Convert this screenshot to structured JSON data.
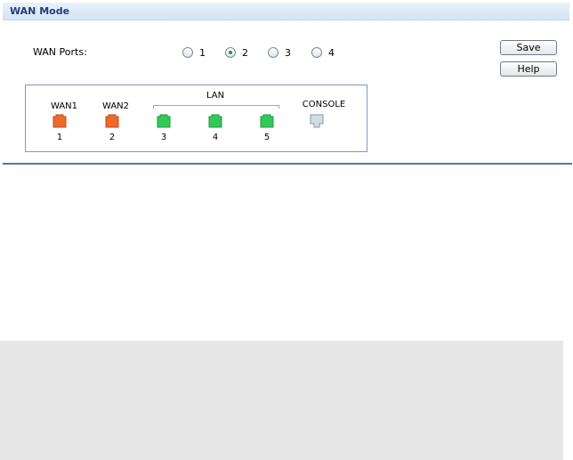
{
  "header": {
    "title": "WAN Mode"
  },
  "wan_ports": {
    "label": "WAN Ports:",
    "options": [
      "1",
      "2",
      "3",
      "4"
    ],
    "selected": "2"
  },
  "buttons": {
    "save": "Save",
    "help": "Help"
  },
  "panel": {
    "lan_label": "LAN",
    "ports": [
      {
        "top_label": "WAN1",
        "number": "1",
        "type": "wan"
      },
      {
        "top_label": "WAN2",
        "number": "2",
        "type": "wan"
      },
      {
        "top_label": "",
        "number": "3",
        "type": "lan"
      },
      {
        "top_label": "",
        "number": "4",
        "type": "lan"
      },
      {
        "top_label": "",
        "number": "5",
        "type": "lan"
      }
    ],
    "console_label": "CONSOLE"
  },
  "colors": {
    "wan": "#f0692a",
    "lan": "#33c85a",
    "console": "#d3dbe3",
    "separator": "#4a78a8"
  }
}
